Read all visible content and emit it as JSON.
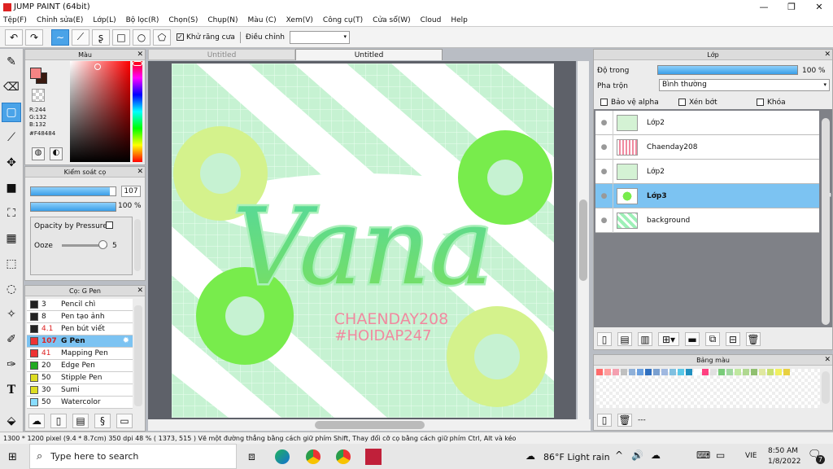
{
  "window": {
    "title": "JUMP PAINT (64bit)"
  },
  "menu": [
    "Tệp(F)",
    "Chỉnh sửa(E)",
    "Lớp(L)",
    "Bộ lọc(R)",
    "Chọn(S)",
    "Chụp(N)",
    "Màu (C)",
    "Xem(V)",
    "Công cụ(T)",
    "Cửa sổ(W)",
    "Cloud",
    "Help"
  ],
  "toolbar": {
    "antialias_label": "Khử răng cưa",
    "adjust_label": "Điều chỉnh",
    "adjust_value": ""
  },
  "color_panel": {
    "title": "Màu",
    "r": "R:244",
    "g": "G:132",
    "b": "B:132",
    "hex": "#F48484",
    "primary": "#f48484",
    "secondary": "#3a1a10"
  },
  "brush_control": {
    "title": "Kiểm soát cọ",
    "size": "107",
    "opacity": "100 %",
    "opacity_pressure_label": "Opacity by Pressure",
    "ooze_label": "Ooze",
    "ooze_value": "5",
    "size_level": 0.93,
    "opacity_level": 1.0,
    "ooze_level": 0.9
  },
  "brush_list": {
    "title": "Cọ: G Pen",
    "items": [
      {
        "size": "3",
        "name": "Pencil chì",
        "color": "#222222"
      },
      {
        "size": "8",
        "name": "Pen tạo ảnh",
        "color": "#222222"
      },
      {
        "size": "4.1",
        "name": "Pen bút viết",
        "color": "#222222"
      },
      {
        "size": "107",
        "name": "G Pen",
        "color": "#ee3333"
      },
      {
        "size": "41",
        "name": "Mapping Pen",
        "color": "#ee3333"
      },
      {
        "size": "20",
        "name": "Edge Pen",
        "color": "#22aa22"
      },
      {
        "size": "50",
        "name": "Stipple Pen",
        "color": "#dddd22"
      },
      {
        "size": "30",
        "name": "Sumi",
        "color": "#dddd22"
      },
      {
        "size": "50",
        "name": "Watercolor",
        "color": "#88ddff"
      }
    ]
  },
  "tabs": [
    "Untitled",
    "Untitled"
  ],
  "canvas": {
    "title_text": "Vana",
    "line1": "CHAENDAY208",
    "line2": "#HOIDAP247"
  },
  "layer_panel": {
    "title": "Lớp",
    "opacity_label": "Độ trong",
    "opacity_value": "100 %",
    "blend_label": "Pha trộn",
    "blend_value": "Bình thường",
    "protect_alpha": "Bảo vệ alpha",
    "clipping": "Xén bớt",
    "lock": "Khóa",
    "layers": [
      "Lớp2",
      "Chaenday208",
      "Lớp2",
      "Lớp3",
      "background"
    ]
  },
  "palette_panel": {
    "title": "Bảng màu",
    "ellipsis": "---",
    "colors": [
      "#ff6b6b",
      "#ff9e9e",
      "#f4a0b0",
      "#c0c0c0",
      "#8fb0d8",
      "#6aa0e0",
      "#3070c0",
      "#7aa0d0",
      "#a0b8e0",
      "#80c0e0",
      "#5ac8e8",
      "#2090c0",
      "#ffffff",
      "#ff4080",
      "#e0e0e0",
      "#7acc7a",
      "#a0d8a0",
      "#c0e8a0",
      "#b0d890",
      "#90c070",
      "#e0e8a0",
      "#c8e070",
      "#f0f060",
      "#e8d040"
    ]
  },
  "status": {
    "text": "1300 * 1200 pixel  (9.4 * 8.7cm)  350 dpi   48 %   ( 1373, 515 )  Vẽ một đường thẳng bằng cách giữ phím Shift, Thay đổi cỡ cọ bằng cách giữ phím Ctrl, Alt và kéo"
  },
  "taskbar": {
    "search_placeholder": "Type here to search",
    "weather": "86°F  Light rain",
    "lang": "VIE",
    "time": "8:50 AM",
    "date": "1/8/2022",
    "badge": "7"
  }
}
